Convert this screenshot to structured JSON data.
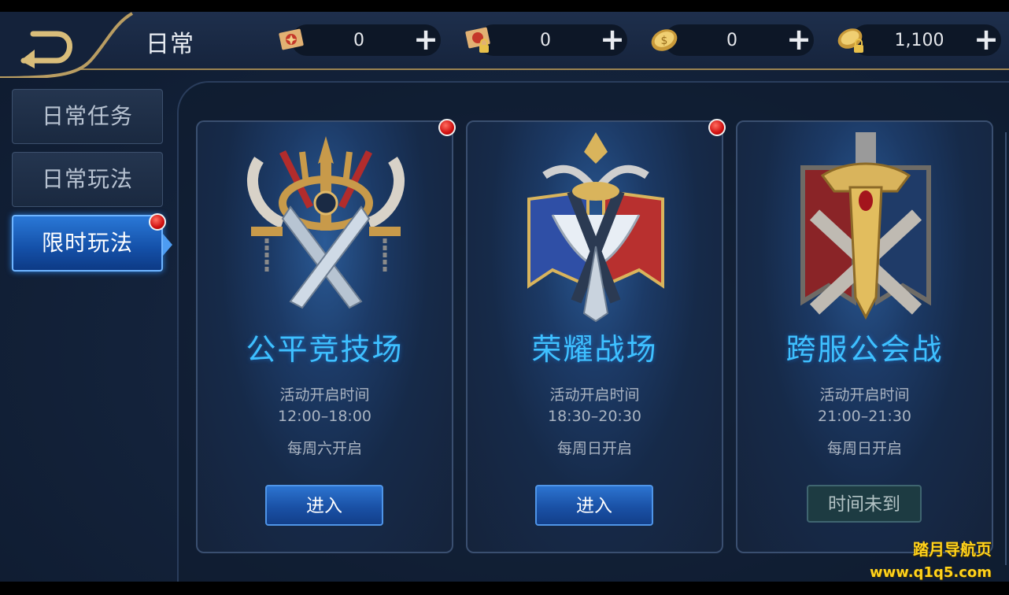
{
  "header": {
    "title": "日常",
    "resources": [
      {
        "icon": "scroll-ticket-icon",
        "value": "0"
      },
      {
        "icon": "locked-scroll-ticket-icon",
        "value": "0"
      },
      {
        "icon": "gold-coin-icon",
        "value": "0"
      },
      {
        "icon": "locked-coin-icon",
        "value": "1,100"
      }
    ]
  },
  "sidebar": {
    "items": [
      {
        "label": "日常任务",
        "active": false
      },
      {
        "label": "日常玩法",
        "active": false
      },
      {
        "label": "限时玩法",
        "active": true,
        "badge": true
      }
    ]
  },
  "events": [
    {
      "name": "公平竞技场",
      "time_label": "活动开启时间",
      "time": "12:00–18:00",
      "day": "每周六开启",
      "button": "进入",
      "enabled": true,
      "badge": true,
      "emblem": "crossed-swords-trident-emblem"
    },
    {
      "name": "荣耀战场",
      "time_label": "活动开启时间",
      "time": "18:30–20:30",
      "day": "每周日开启",
      "button": "进入",
      "enabled": true,
      "badge": true,
      "emblem": "winged-crossed-blades-emblem"
    },
    {
      "name": "跨服公会战",
      "time_label": "活动开启时间",
      "time": "21:00–21:30",
      "day": "每周日开启",
      "button": "时间未到",
      "enabled": false,
      "badge": false,
      "emblem": "golden-sword-banner-emblem"
    }
  ],
  "watermark": {
    "line1": "踏月导航页",
    "line2": "www.q1q5.com"
  },
  "colors": {
    "accent_blue": "#3ec0ff",
    "active_tab": "#1f63c4",
    "gold_border": "#9c8451",
    "badge_red": "#d01010",
    "watermark": "#ffd21c"
  }
}
